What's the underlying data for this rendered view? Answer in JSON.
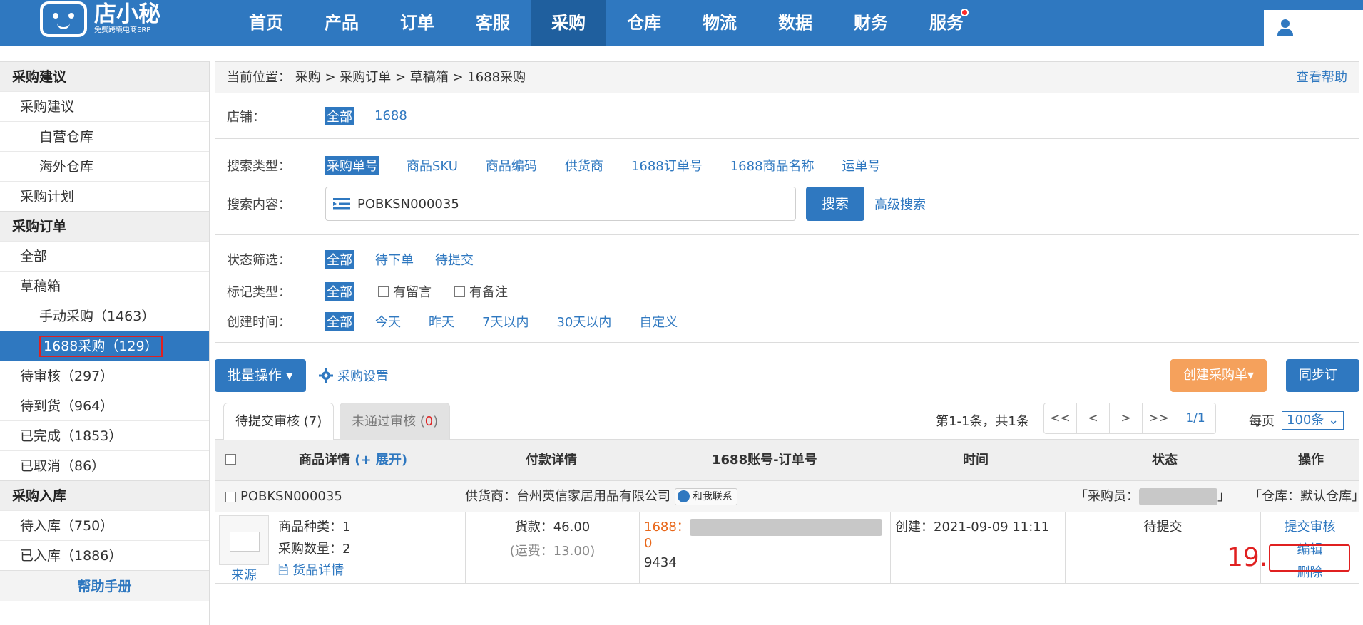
{
  "app": {
    "logo_name": "店小秘",
    "logo_sub": "免费跨境电商ERP"
  },
  "nav": {
    "items": [
      "首页",
      "产品",
      "订单",
      "客服",
      "采购",
      "仓库",
      "物流",
      "数据",
      "财务",
      "服务"
    ],
    "active": "采购"
  },
  "sidebar": {
    "sec1": "采购建议",
    "sec1_items": [
      "采购建议",
      "自营仓库",
      "海外仓库",
      "采购计划"
    ],
    "sec2": "采购订单",
    "sec2_items": [
      "全部",
      "草稿箱",
      "手动采购（1463）",
      "1688采购（129）",
      "待审核（297）",
      "待到货（964）",
      "已完成（1853）",
      "已取消（86）"
    ],
    "sec3": "采购入库",
    "sec3_items": [
      "待入库（750）",
      "已入库（1886）"
    ],
    "help": "帮助手册"
  },
  "breadcrumb": {
    "label": "当前位置：",
    "path": "采购 > 采购订单 > 草稿箱 > 1688采购",
    "help": "查看帮助"
  },
  "filters": {
    "shop_label": "店铺：",
    "shop_opts": [
      "全部",
      "1688"
    ],
    "search_type_label": "搜索类型：",
    "search_types": [
      "采购单号",
      "商品SKU",
      "商品编码",
      "供货商",
      "1688订单号",
      "1688商品名称",
      "运单号"
    ],
    "search_content_label": "搜索内容：",
    "search_value": "POBKSN000035",
    "search_btn": "搜索",
    "advanced": "高级搜索",
    "status_label": "状态筛选：",
    "status_opts": [
      "全部",
      "待下单",
      "待提交"
    ],
    "mark_label": "标记类型：",
    "mark_all": "全部",
    "mark_checks": [
      "有留言",
      "有备注"
    ],
    "time_label": "创建时间：",
    "time_opts": [
      "全部",
      "今天",
      "昨天",
      "7天以内",
      "30天以内",
      "自定义"
    ]
  },
  "toolbar": {
    "batch": "批量操作 ▾",
    "settings": "采购设置",
    "create": "创建采购单▾",
    "sync": "同步订单"
  },
  "tabs": {
    "tab1": "待提交审核 (7)",
    "tab2_label": "未通过审核 (",
    "tab2_count": "0",
    "tab2_close": ")"
  },
  "pagination": {
    "info": "第1-1条，共1条",
    "buttons": [
      "<<",
      "<",
      ">",
      ">>",
      "1/1"
    ],
    "perpage_label": "每页",
    "perpage": "100条 ⌄"
  },
  "table": {
    "headers": {
      "product": "商品详情",
      "expand": "(+ 展开)",
      "payment": "付款详情",
      "account": "1688账号-订单号",
      "time": "时间",
      "status": "状态",
      "ops": "操作"
    },
    "order": {
      "no": "POBKSN000035",
      "supplier_label": "供货商：",
      "supplier": "台州英信家居用品有限公司",
      "contact": "和我联系",
      "buyer_label": "「采购员：",
      "buyer_close": "」",
      "warehouse": "「仓库：默认仓库」"
    },
    "detail": {
      "kind": "商品种类：1",
      "qty": "采购数量：2",
      "goods_detail": "货品详情",
      "source": "来源",
      "goods_fee": "货款：46.00",
      "shipping": "(运费：13.00)",
      "acct_label": "1688：",
      "acct_end": "0",
      "order_tail": "9434",
      "created": "创建：2021-09-09 11:11",
      "status": "待提交",
      "ops": [
        "提交审核",
        "编辑",
        "删除"
      ]
    }
  },
  "annotation": {
    "step": "19."
  }
}
